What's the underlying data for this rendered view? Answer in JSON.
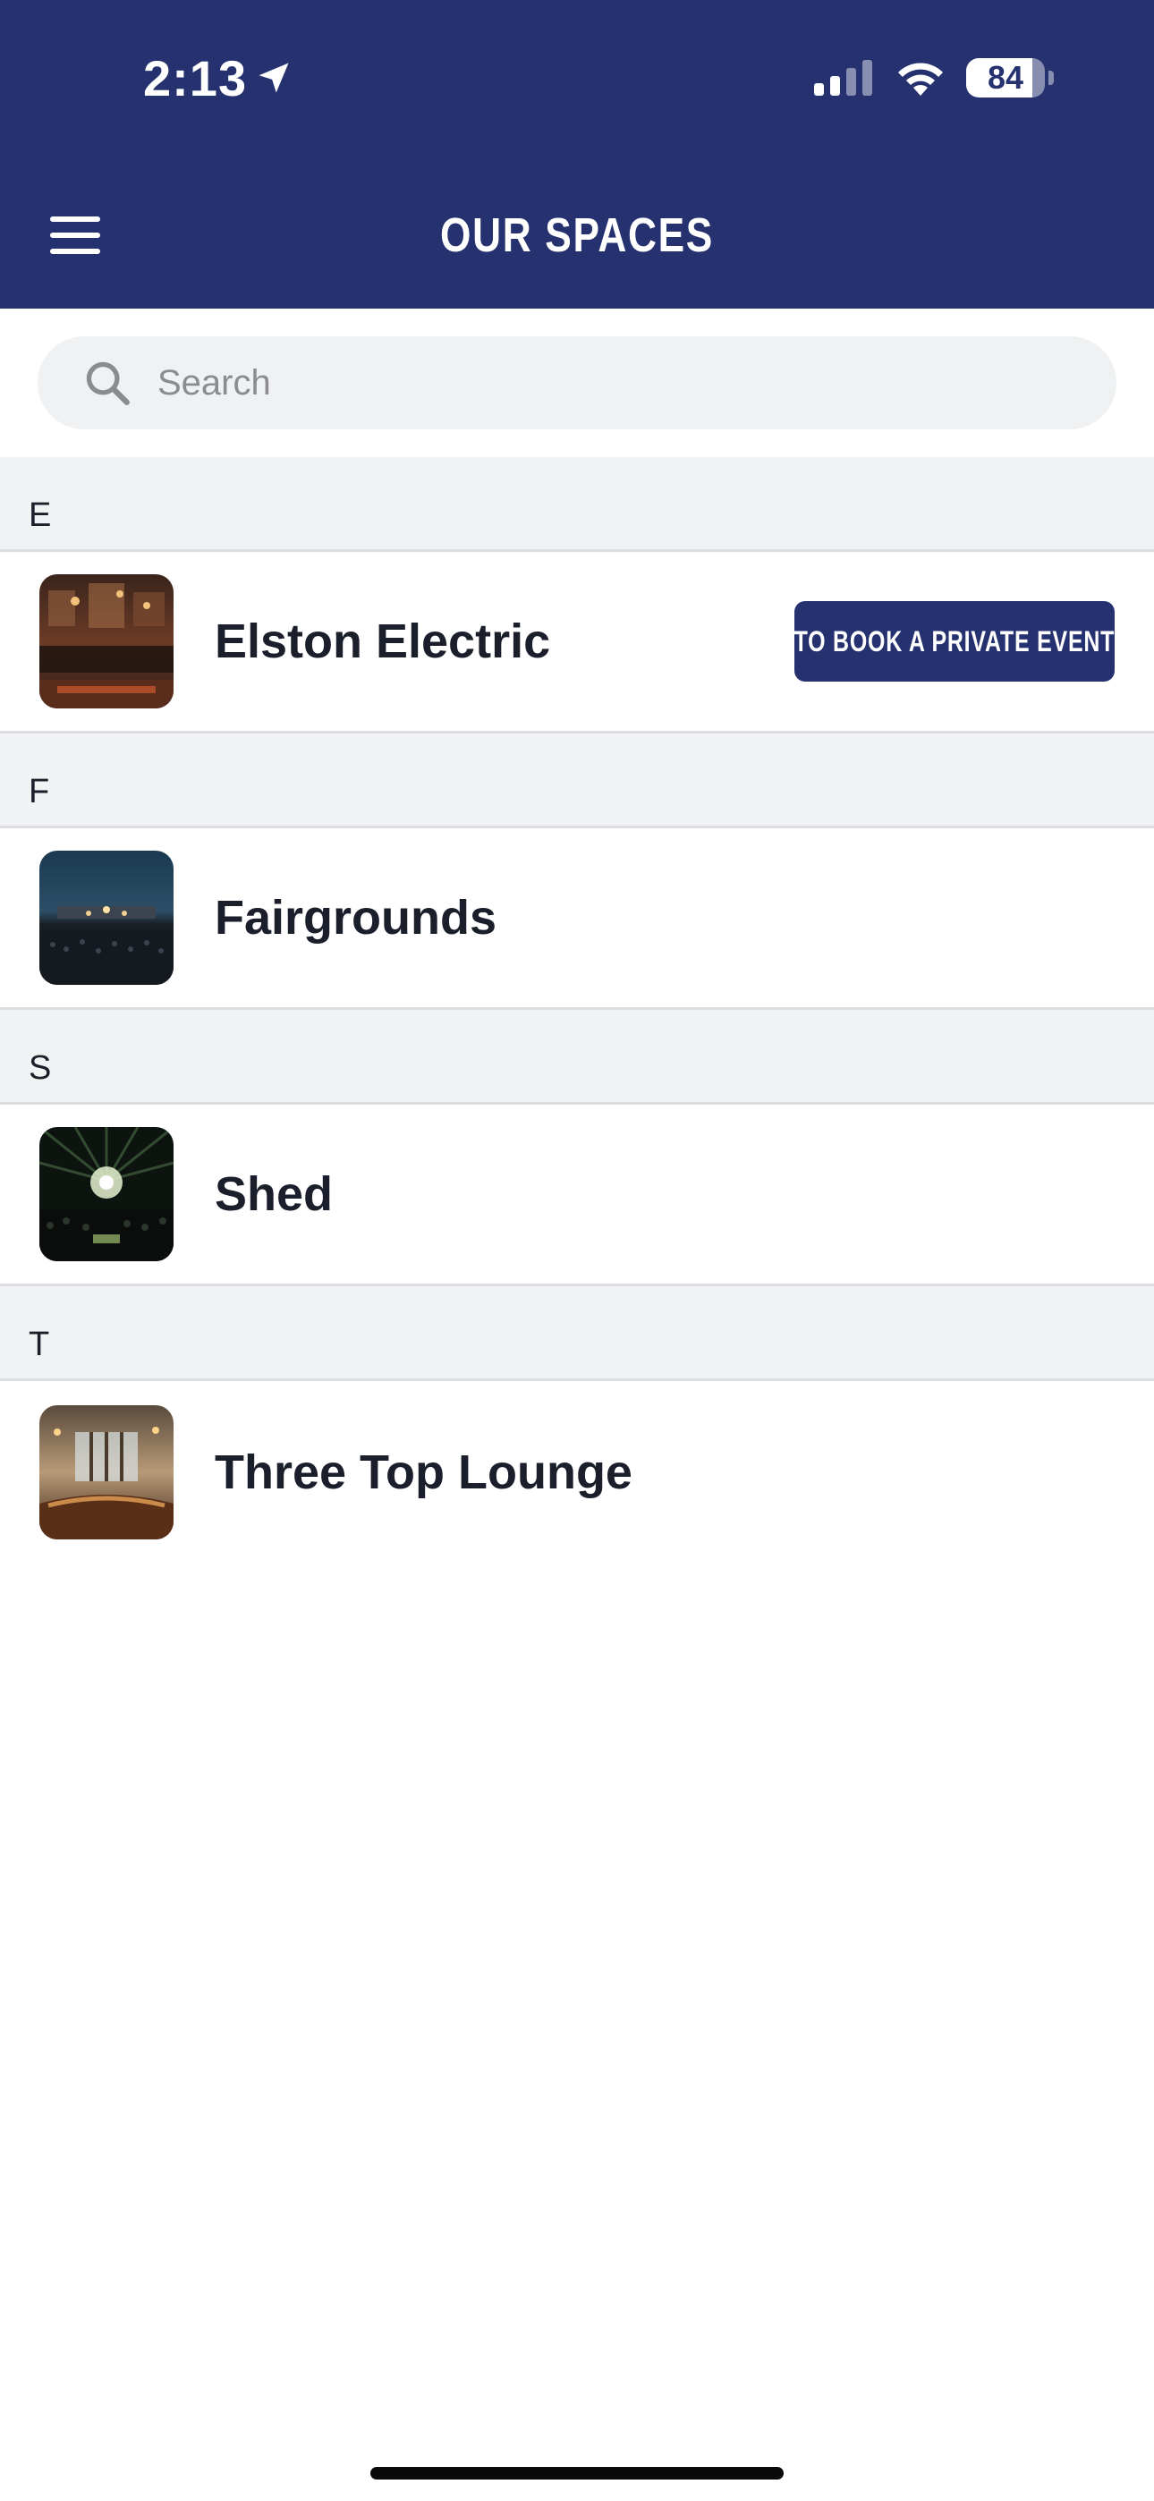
{
  "status_bar": {
    "time": "2:13",
    "battery_level": "84",
    "battery_fraction": 0.84,
    "location_icon": "location-arrow-icon",
    "signal_icon": "cellular-signal-icon",
    "wifi_icon": "wifi-icon"
  },
  "header": {
    "title": "OUR SPACES",
    "menu_icon": "hamburger-menu-icon",
    "background_color": "#263270"
  },
  "search": {
    "placeholder": "Search",
    "value": ""
  },
  "sections": [
    {
      "letter": "E",
      "items": [
        {
          "name": "Elston Electric",
          "thumb": "elston-electric-thumbnail",
          "action_label": "TO BOOK A PRIVATE EVENT"
        }
      ]
    },
    {
      "letter": "F",
      "items": [
        {
          "name": "Fairgrounds",
          "thumb": "fairgrounds-thumbnail"
        }
      ]
    },
    {
      "letter": "S",
      "items": [
        {
          "name": "Shed",
          "thumb": "shed-thumbnail"
        }
      ]
    },
    {
      "letter": "T",
      "items": [
        {
          "name": "Three Top Lounge",
          "thumb": "three-top-lounge-thumbnail"
        }
      ]
    }
  ]
}
